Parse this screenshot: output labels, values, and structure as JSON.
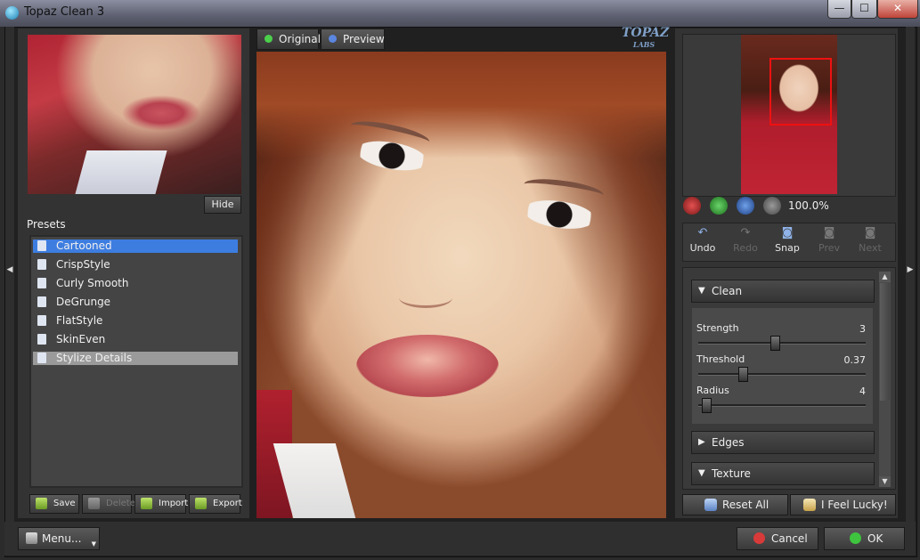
{
  "window": {
    "title": "Topaz Clean 3",
    "min": "—",
    "max": "☐",
    "close": "✕"
  },
  "left": {
    "hide_label": "Hide",
    "presets_label": "Presets",
    "presets": [
      "Cartooned",
      "CrispStyle",
      "Curly Smooth",
      "DeGrunge",
      "FlatStyle",
      "SkinEven",
      "Stylize Details"
    ],
    "selected_preset": "Cartooned",
    "buttons": {
      "save": "Save",
      "delete": "Delete",
      "import": "Import",
      "export": "Export"
    }
  },
  "tabs": {
    "original": "Original",
    "preview": "Preview",
    "active": "Preview"
  },
  "logo": {
    "text": "TOPAZ",
    "subtext": "LABS"
  },
  "navigator": {
    "zoom_level": "100.0%"
  },
  "history": {
    "undo": "Undo",
    "redo": "Redo",
    "snap": "Snap",
    "prev": "Prev",
    "next": "Next"
  },
  "adjust": {
    "sections": {
      "clean": "Clean",
      "edges": "Edges",
      "texture": "Texture"
    },
    "sliders": [
      {
        "label": "Strength",
        "value": "3",
        "fraction": 0.45
      },
      {
        "label": "Threshold",
        "value": "0.37",
        "fraction": 0.25
      },
      {
        "label": "Radius",
        "value": "4",
        "fraction": 0.02
      }
    ]
  },
  "actions": {
    "reset_all": "Reset All",
    "feel_lucky": "I Feel Lucky!"
  },
  "bottom": {
    "menu": "Menu...",
    "cancel": "Cancel",
    "ok": "OK"
  },
  "colors": {
    "selected": "#3d7de0",
    "frame": "#e11111",
    "ok_icon": "#3ec43e",
    "cancel_icon": "#d83a3a"
  }
}
